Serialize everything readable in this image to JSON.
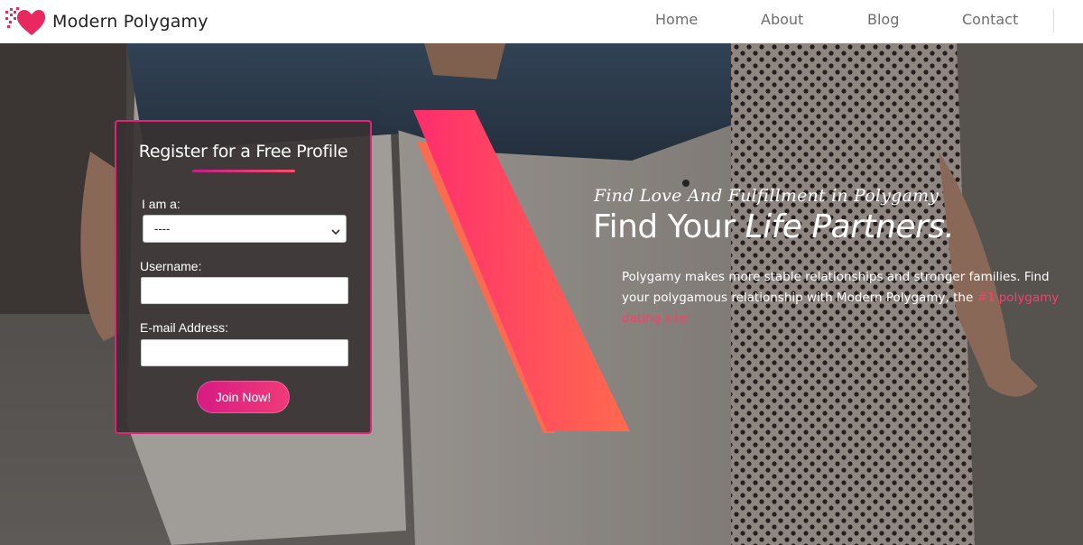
{
  "header": {
    "brand_name": "Modern Polygamy",
    "logo_icon": "heart-pixel-icon",
    "nav": [
      {
        "label": "Home"
      },
      {
        "label": "About"
      },
      {
        "label": "Blog"
      },
      {
        "label": "Contact"
      }
    ]
  },
  "register_form": {
    "title": "Register for a Free Profile",
    "i_am_label": "I am a:",
    "i_am_selected": "----",
    "username_label": "Username:",
    "username_value": "",
    "email_label": "E-mail Address:",
    "email_value": "",
    "submit_label": "Join Now!"
  },
  "hero": {
    "tagline": "Find Love And Fulfillment in Polygamy",
    "headline_part1": "Find Your",
    "headline_part2": "Life Partners.",
    "description_text": "Polygamy makes more stable relationships and stronger families. Find your polygamous relationship with Modern Polygamy, the",
    "description_link": "#1 polygamy dating site!"
  },
  "colors": {
    "accent_pink": "#e0247a",
    "link_red": "#ff3d6b",
    "slash_gradient_start": "#ff2d6e",
    "slash_gradient_end": "#ff6a4d"
  }
}
